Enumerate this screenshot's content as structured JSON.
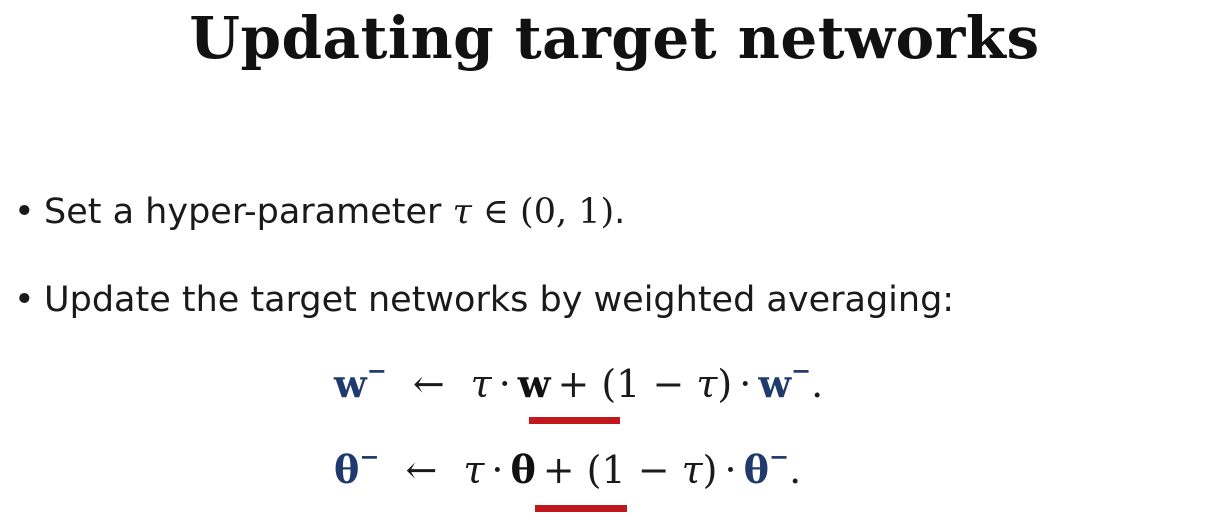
{
  "slide": {
    "title": "Updating target networks",
    "bullets": [
      {
        "marker": "•",
        "text": "Set a hyper-parameter ",
        "math_symbol": "τ",
        "math_rest": " ∈ (0, 1)",
        "end": "."
      },
      {
        "marker": "•",
        "text": "Update the target networks by weighted averaging:"
      }
    ],
    "equations": [
      {
        "lhs_var": "w",
        "lhs_sup": "−",
        "arrow": "←",
        "tau1": "τ",
        "dot1": "·",
        "mid_var": "w",
        "plus": "+",
        "paren": "(1 − ",
        "tau2": "τ",
        "paren_close": ")",
        "dot2": "·",
        "rhs_var": "w",
        "rhs_sup": "−",
        "end": "."
      },
      {
        "lhs_var": "θ",
        "lhs_sup": "−",
        "arrow": "←",
        "tau1": "τ",
        "dot1": "·",
        "mid_var": "θ",
        "plus": "+",
        "paren": "(1 − ",
        "tau2": "τ",
        "paren_close": ")",
        "dot2": "·",
        "rhs_var": "θ",
        "rhs_sup": "−",
        "end": "."
      }
    ],
    "colors": {
      "variable": "#1f3b6e",
      "underline": "#c0181c",
      "text": "#1a1a1a"
    }
  }
}
